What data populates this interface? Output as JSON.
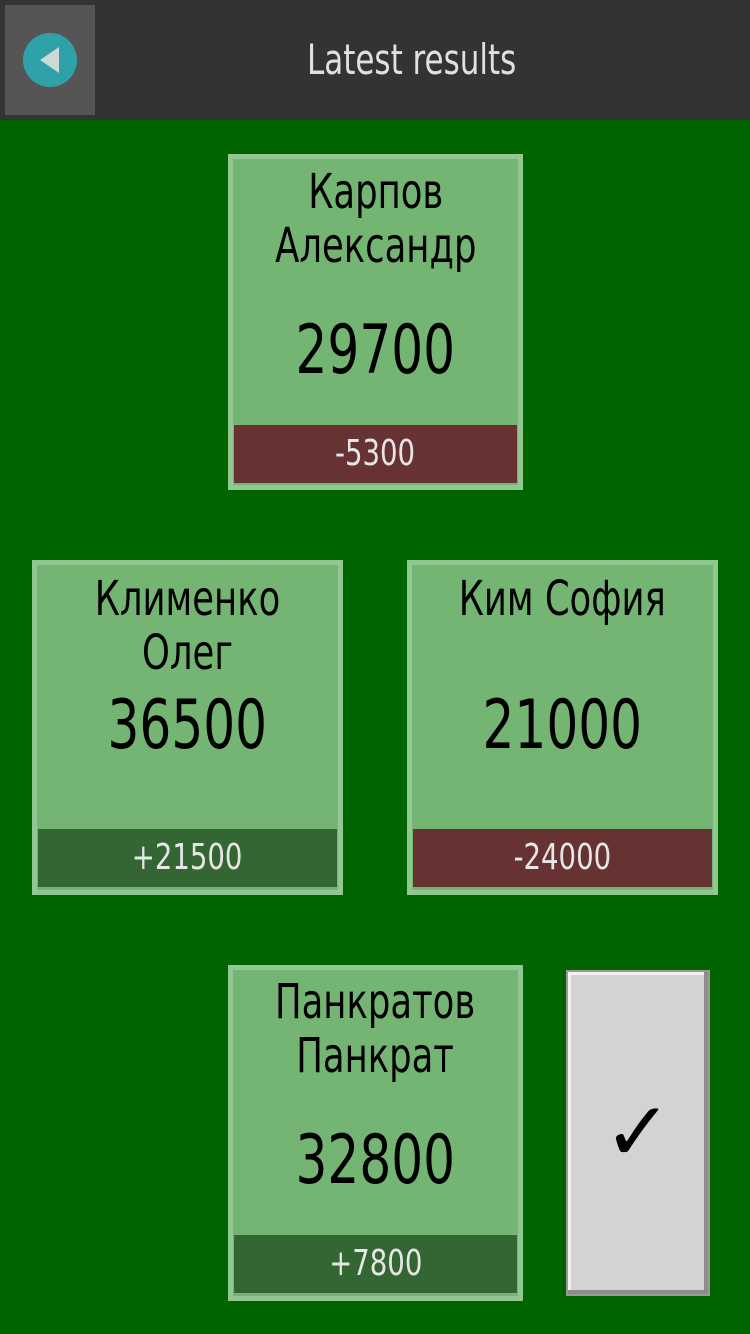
{
  "header": {
    "title": "Latest results",
    "back_icon": "back-arrow-circle-icon",
    "accent_color": "#2fa1a8"
  },
  "players": [
    {
      "name": "Карпов\nАлександр",
      "score": "29700",
      "delta": "-5300",
      "delta_sign": "negative"
    },
    {
      "name": "Клименко Олег",
      "score": "36500",
      "delta": "+21500",
      "delta_sign": "positive"
    },
    {
      "name": "Ким София",
      "score": "21000",
      "delta": "-24000",
      "delta_sign": "negative"
    },
    {
      "name": "Панкратов\nПанкрат",
      "score": "32800",
      "delta": "+7800",
      "delta_sign": "positive"
    }
  ],
  "confirm": {
    "icon": "checkmark-icon",
    "glyph": "✓"
  },
  "colors": {
    "background": "#006400",
    "card": "#74b574",
    "negative": "#673232",
    "positive": "#336633"
  }
}
